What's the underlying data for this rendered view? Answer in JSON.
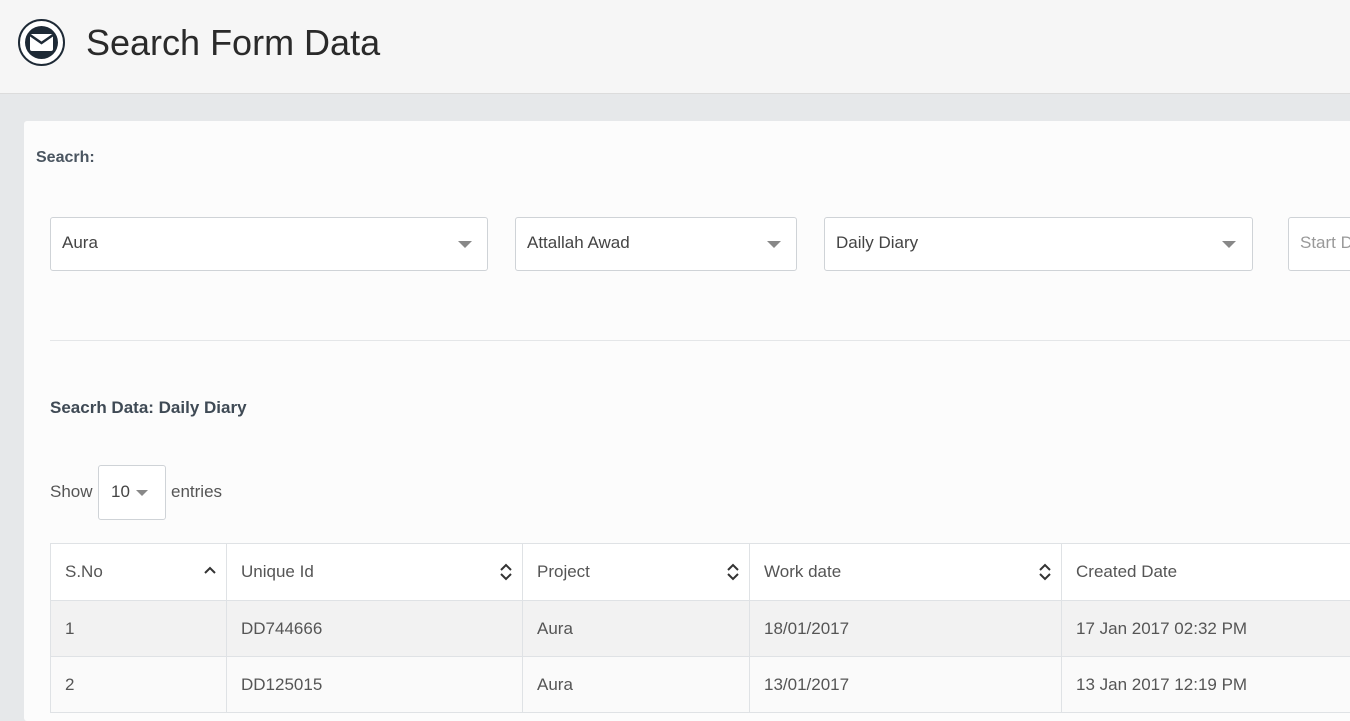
{
  "header": {
    "title": "Search Form Data",
    "logo_icon": "envelope-icon"
  },
  "search": {
    "label": "Seacrh:",
    "project_value": "Aura",
    "user_value": "Attallah Awad",
    "form_value": "Daily Diary",
    "start_date_placeholder": "Start D"
  },
  "results": {
    "label": "Seacrh Data: Daily Diary",
    "show_label": "Show",
    "entries_value": "10",
    "entries_label": "entries"
  },
  "table": {
    "columns": [
      "S.No",
      "Unique Id",
      "Project",
      "Work date",
      "Created Date"
    ],
    "rows": [
      [
        "1",
        "DD744666",
        "Aura",
        "18/01/2017",
        "17 Jan 2017 02:32 PM"
      ],
      [
        "2",
        "DD125015",
        "Aura",
        "13/01/2017",
        "13 Jan 2017 12:19 PM"
      ]
    ]
  },
  "colors": {
    "header_bg": "#f6f6f6",
    "logo_dark": "#1e2a36",
    "page_bg": "#e6e8ea"
  }
}
